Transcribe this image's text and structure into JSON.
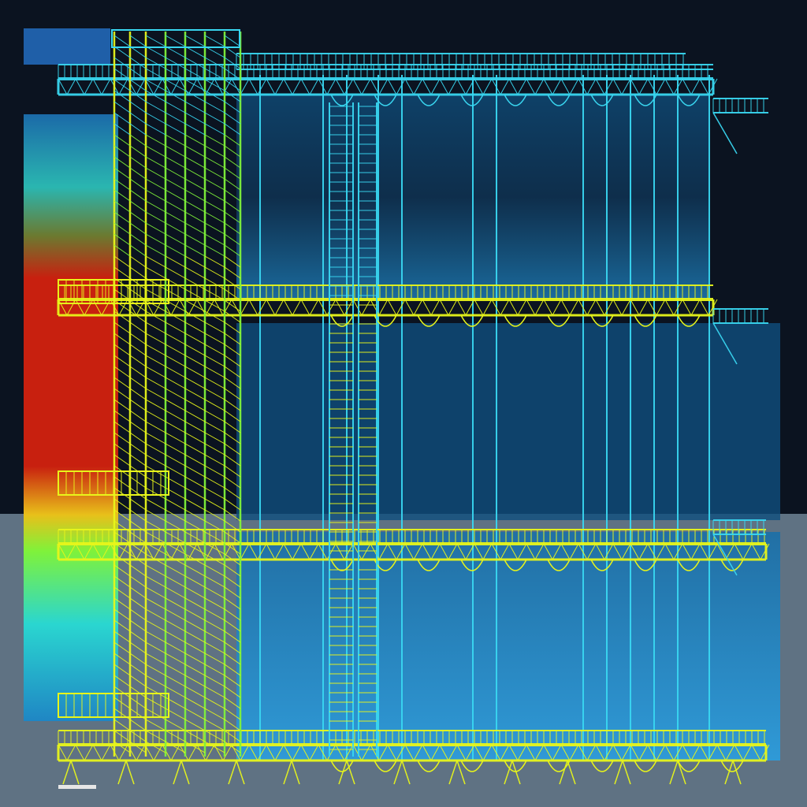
{
  "scene": {
    "subject": "steel-scaffold-tower",
    "render_style": "wireframe-heatmap",
    "floors_visible": 4,
    "colors": {
      "night_sky": "#0b1320",
      "ground": "#5f7283",
      "cyan_structure": "#39d6f0",
      "yellow_structure": "#e8f51a",
      "green_structure": "#7ff23a",
      "blue_panel": "#1f86c4",
      "deep_blue_panel": "#0f4f7e",
      "heat_red": "#c8200f",
      "heat_orange": "#e0600a",
      "heat_teal": "#2ab6b0",
      "scale_bar": "#e6e6e6"
    }
  }
}
